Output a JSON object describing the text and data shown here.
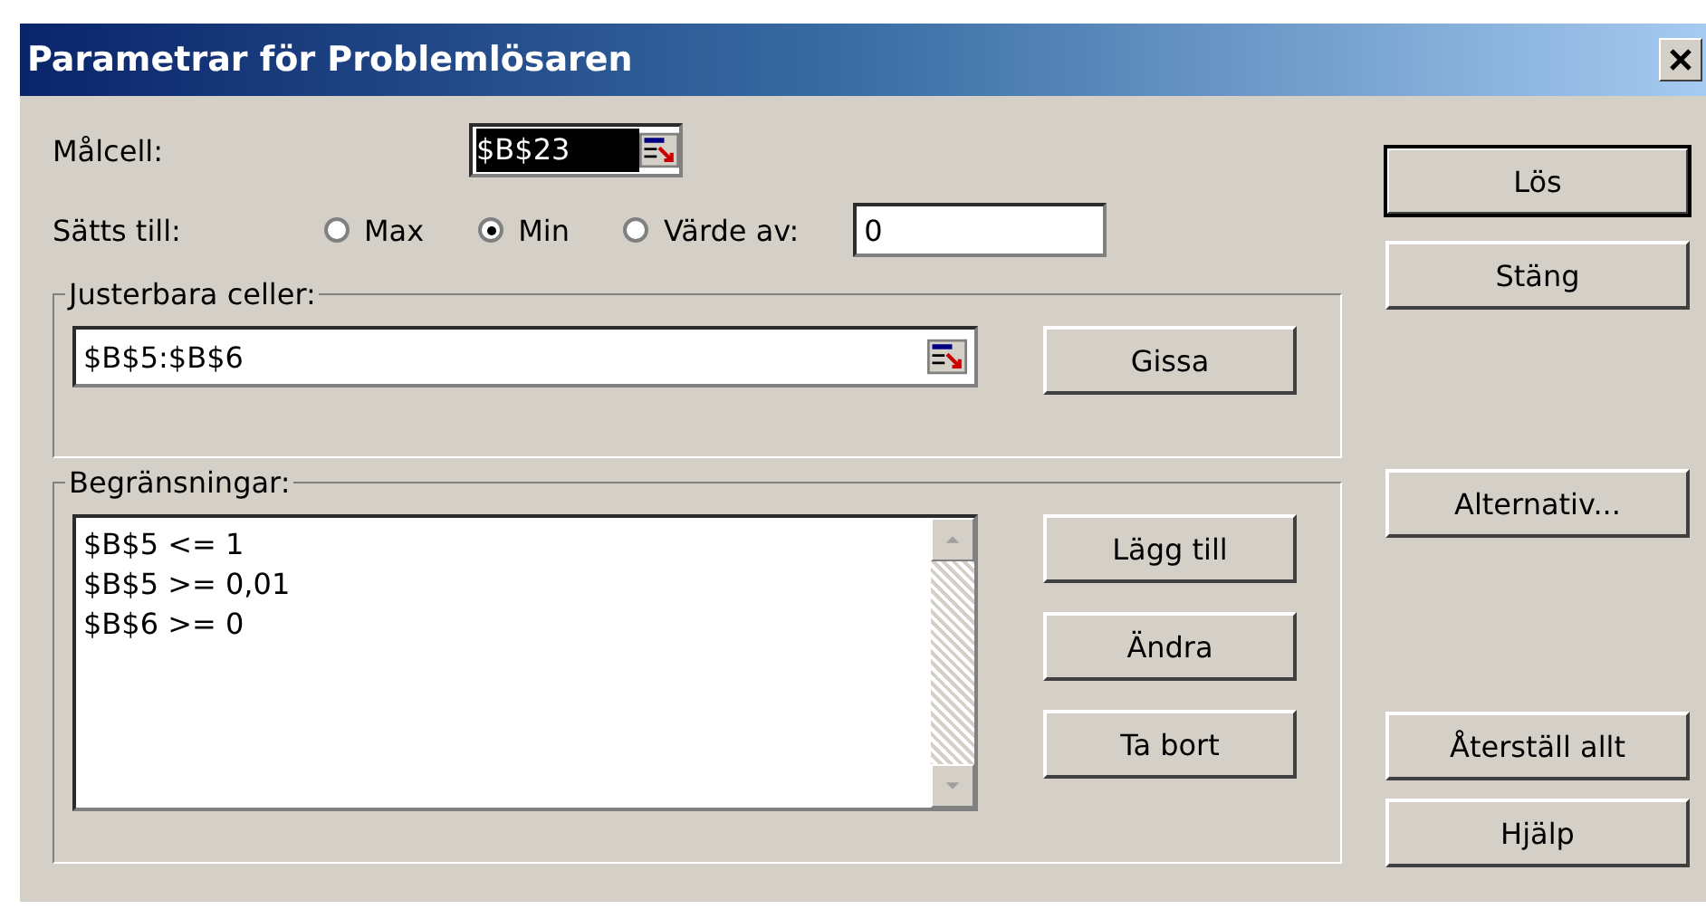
{
  "window": {
    "title": "Parametrar för Problemlösaren"
  },
  "target_cell": {
    "label": "Målcell:",
    "value": "$B$23",
    "selected": true
  },
  "set_to": {
    "label": "Sätts till:",
    "options": [
      {
        "label": "Max",
        "selected": false
      },
      {
        "label": "Min",
        "selected": true
      },
      {
        "label": "Värde av:",
        "selected": false
      }
    ],
    "value": "0"
  },
  "adjustable_cells": {
    "label": "Justerbara celler:",
    "value": "$B$5:$B$6",
    "button": "Gissa"
  },
  "constraints": {
    "label": "Begränsningar:",
    "items": [
      "$B$5 <= 1",
      "$B$5 >= 0,01",
      "$B$6 >= 0"
    ],
    "buttons": [
      "Lägg till",
      "Ändra",
      "Ta bort"
    ]
  },
  "buttons": [
    {
      "label": "Lös",
      "default": true
    },
    {
      "label": "Stäng",
      "default": false
    },
    {
      "label": "Alternativ...",
      "default": false
    },
    {
      "label": "Återställ allt",
      "default": false
    },
    {
      "label": "Hjälp",
      "default": false
    }
  ]
}
